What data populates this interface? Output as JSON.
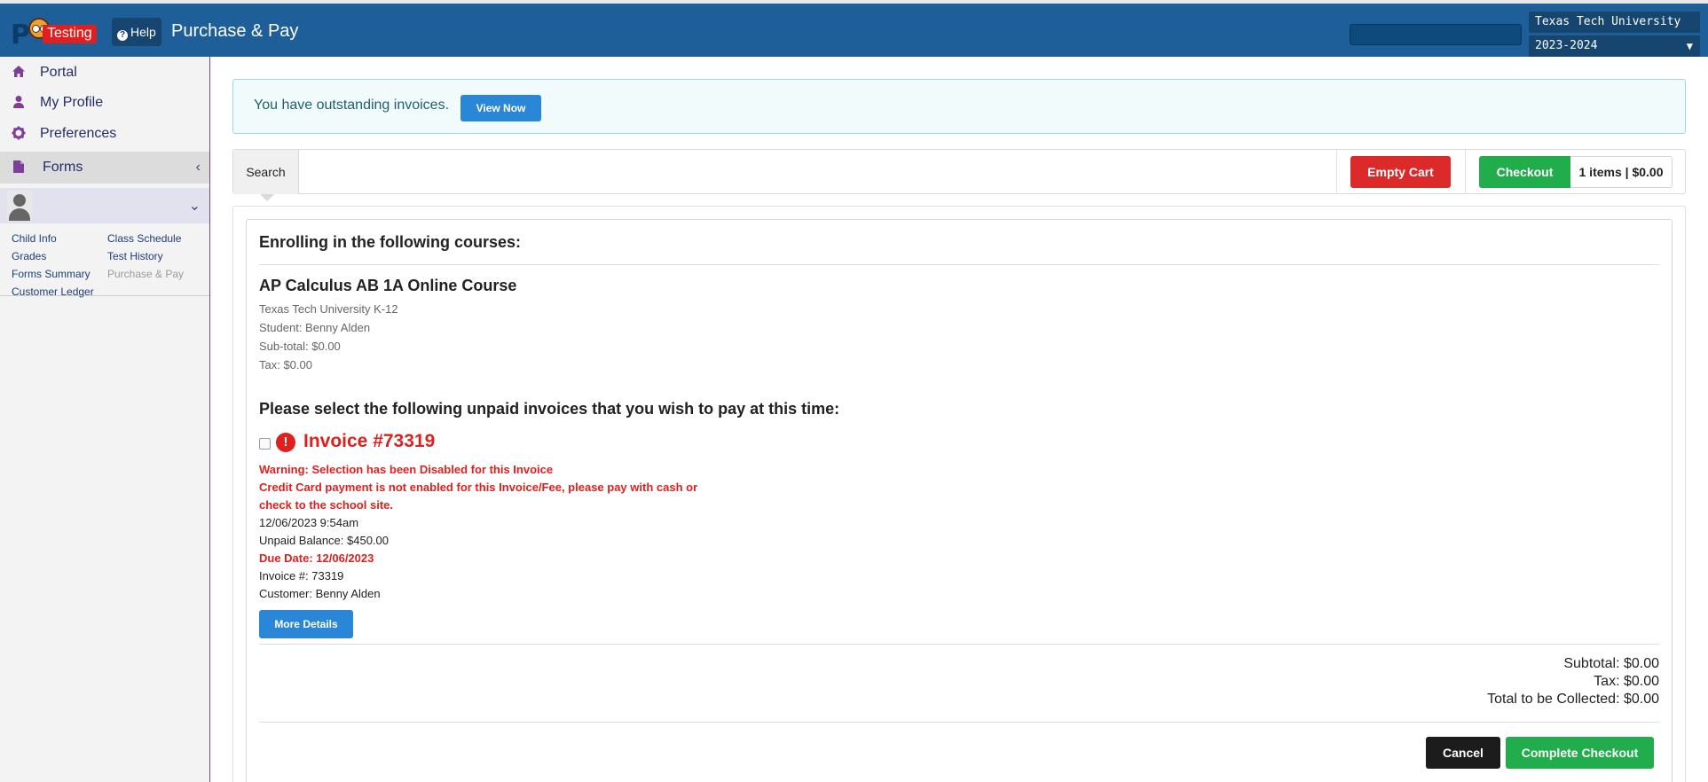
{
  "header": {
    "logo_badge": "Testing",
    "help_label": "Help",
    "title": "Purchase & Pay",
    "search_value": "",
    "organization": "Texas Tech University K-12",
    "school_year": "2023-2024"
  },
  "sidebar": {
    "items": [
      {
        "label": "Portal",
        "icon": "home-icon"
      },
      {
        "label": "My Profile",
        "icon": "user-icon"
      },
      {
        "label": "Preferences",
        "icon": "gear-icon"
      },
      {
        "label": "Forms",
        "icon": "document-icon"
      }
    ],
    "student_links": [
      {
        "label": "Child Info"
      },
      {
        "label": "Class Schedule"
      },
      {
        "label": "Grades"
      },
      {
        "label": "Test History"
      },
      {
        "label": "Forms Summary"
      },
      {
        "label": "Purchase & Pay"
      },
      {
        "label": "Customer Ledger"
      }
    ]
  },
  "alert": {
    "message": "You have outstanding invoices.",
    "button_label": "View Now"
  },
  "toolbar": {
    "search_tab": "Search",
    "empty_cart_label": "Empty Cart",
    "checkout_label": "Checkout",
    "cart_summary": "1 items | $0.00"
  },
  "enrollment": {
    "heading": "Enrolling in the following courses:",
    "course_title": "AP Calculus AB 1A Online Course",
    "school": "Texas Tech University K-12",
    "student": "Student: Benny Alden",
    "subtotal": "Sub-total: $0.00",
    "tax": "Tax: $0.00"
  },
  "invoices": {
    "heading": "Please select the following unpaid invoices that you wish to pay at this time:",
    "invoice": {
      "title": "Invoice #73319",
      "warning_prefix": "Warning:",
      "warning_text": " Selection has been Disabled for this Invoice",
      "cc_line1": "Credit Card payment is not enabled for this Invoice/Fee, please pay with cash or",
      "cc_line2": "check to the school site.",
      "datetime": "12/06/2023 9:54am",
      "unpaid_balance": "Unpaid Balance: $450.00",
      "due_date": "Due Date: 12/06/2023",
      "invoice_number": "Invoice #: 73319",
      "customer": "Customer: Benny Alden",
      "more_details_label": "More Details"
    }
  },
  "totals": {
    "subtotal": "Subtotal: $0.00",
    "tax": "Tax: $0.00",
    "total": "Total to be Collected: $0.00"
  },
  "actions": {
    "cancel_label": "Cancel",
    "complete_label": "Complete Checkout"
  },
  "colors": {
    "header_bg": "#1e5f99",
    "danger": "#dc2a2a",
    "success": "#21ad4b",
    "primary": "#2a86d6",
    "sidebar_accent": "#7e3f98"
  }
}
